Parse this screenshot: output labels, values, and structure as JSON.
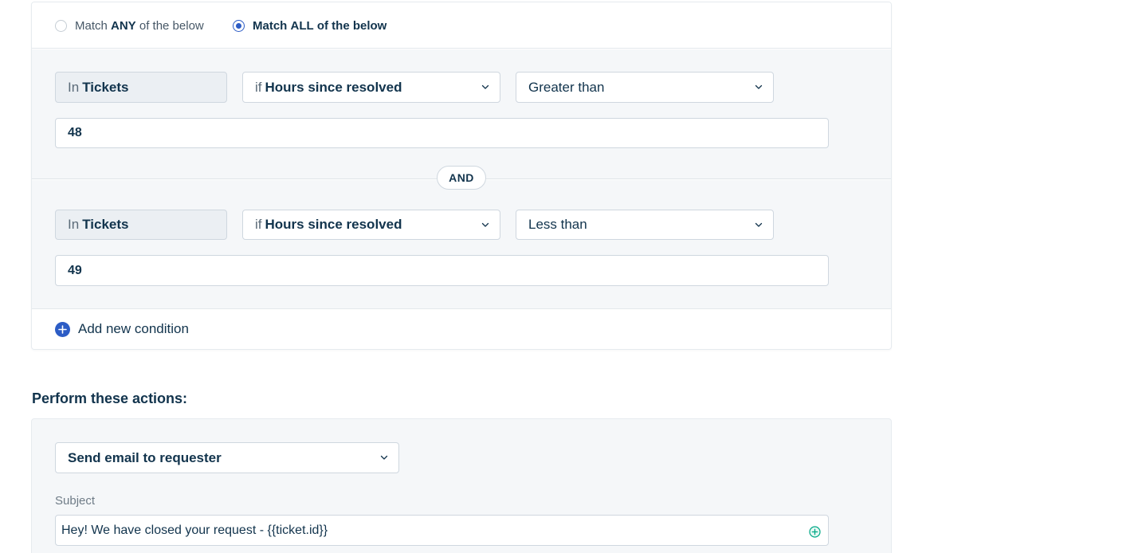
{
  "match": {
    "any_prefix": "Match ",
    "any_bold": "ANY",
    "any_suffix": " of the below",
    "all_prefix": "Match ",
    "all_bold": "ALL",
    "all_suffix": " of the below",
    "selected": "all"
  },
  "conditions": [
    {
      "scope_prefix": "In",
      "scope_value": "Tickets",
      "field_prefix": "if",
      "field_value": "Hours since resolved",
      "operator": "Greater than",
      "value": "48"
    },
    {
      "scope_prefix": "In",
      "scope_value": "Tickets",
      "field_prefix": "if",
      "field_value": "Hours since resolved",
      "operator": "Less than",
      "value": "49"
    }
  ],
  "joiner": "AND",
  "add_condition_label": "Add new condition",
  "actions": {
    "title": "Perform these actions:",
    "action_value": "Send email to requester",
    "subject_label": "Subject",
    "subject_value": "Hey! We have closed your request - {{ticket.id}}"
  },
  "colors": {
    "accent": "#2c5cc5",
    "text": "#12344d",
    "panel_bg": "#f5f7f9",
    "green": "#00a886"
  },
  "icons": {
    "dropdown": "chevron-down-icon",
    "add": "plus-circle-icon",
    "placeholder": "add-placeholder-icon"
  }
}
